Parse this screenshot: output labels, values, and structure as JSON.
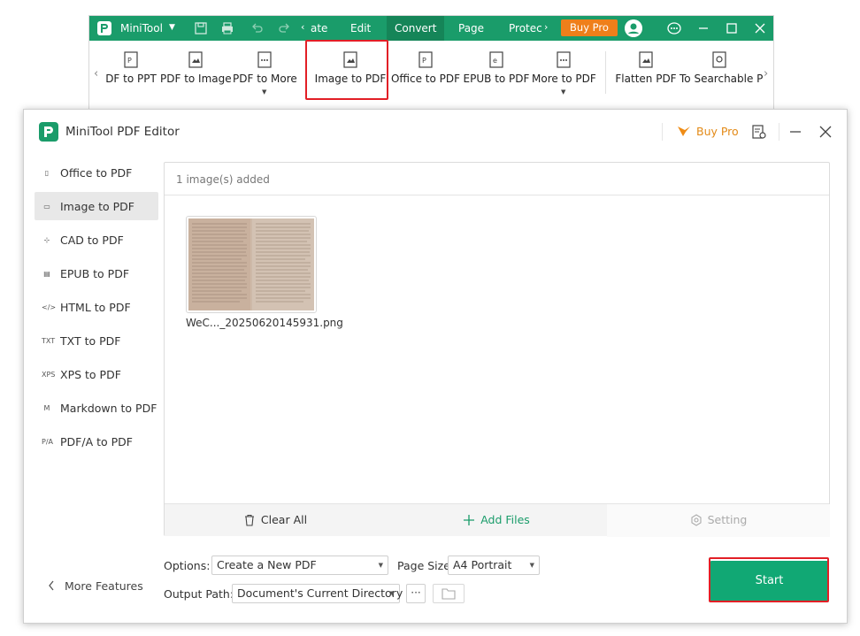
{
  "colors": {
    "brand": "#1a9c6a",
    "buy_pro": "#ef7f1a",
    "highlight": "#e21f26",
    "start": "#11a874"
  },
  "bg_window": {
    "app_name": "MiniTool",
    "menu": [
      "ate",
      "Edit",
      "Convert",
      "Page",
      "Protec"
    ],
    "active_menu": "Convert",
    "buy_pro": "Buy Pro",
    "ribbon": [
      {
        "label": "DF to PPT",
        "icon": "pdf-to-ppt-icon",
        "dropdown": false
      },
      {
        "label": "PDF to Image",
        "icon": "pdf-to-image-icon",
        "dropdown": false
      },
      {
        "label": "PDF to More",
        "icon": "pdf-to-more-icon",
        "dropdown": true
      },
      {
        "label": "Image to PDF",
        "icon": "image-to-pdf-icon",
        "dropdown": false
      },
      {
        "label": "Office to PDF",
        "icon": "office-to-pdf-icon",
        "dropdown": false
      },
      {
        "label": "EPUB to PDF",
        "icon": "epub-to-pdf-icon",
        "dropdown": false
      },
      {
        "label": "More to PDF",
        "icon": "more-to-pdf-icon",
        "dropdown": true
      },
      {
        "label": "Flatten PDF",
        "icon": "flatten-pdf-icon",
        "dropdown": false
      },
      {
        "label": "To Searchable P",
        "icon": "to-searchable-pdf-icon",
        "dropdown": false
      }
    ]
  },
  "dialog": {
    "title": "MiniTool PDF Editor",
    "buy_pro": "Buy Pro",
    "sidebar": [
      {
        "label": "Office to PDF",
        "icon": "office-icon",
        "glyph": "▯",
        "active": false
      },
      {
        "label": "Image to PDF",
        "icon": "image-icon",
        "glyph": "▭",
        "active": true
      },
      {
        "label": "CAD to PDF",
        "icon": "cad-icon",
        "glyph": "⊹",
        "active": false
      },
      {
        "label": "EPUB to PDF",
        "icon": "epub-icon",
        "glyph": "▤",
        "active": false
      },
      {
        "label": "HTML to PDF",
        "icon": "html-icon",
        "glyph": "</>",
        "active": false
      },
      {
        "label": "TXT to PDF",
        "icon": "txt-icon",
        "glyph": "TXT",
        "active": false
      },
      {
        "label": "XPS to PDF",
        "icon": "xps-icon",
        "glyph": "XPS",
        "active": false
      },
      {
        "label": "Markdown to PDF",
        "icon": "markdown-icon",
        "glyph": "M",
        "active": false
      },
      {
        "label": "PDF/A to PDF",
        "icon": "pdfa-icon",
        "glyph": "P/A",
        "active": false
      }
    ],
    "more_features": "More Features",
    "file_count": "1 image(s) added",
    "files": [
      {
        "name": "WeC..._20250620145931.png"
      }
    ],
    "footer": {
      "clear_all": "Clear All",
      "add_files": "Add Files",
      "setting": "Setting"
    },
    "options_label": "Options:",
    "options_value": "Create a New PDF",
    "page_size_label": "Page Size:",
    "page_size_value": "A4 Portrait",
    "output_path_label": "Output Path:",
    "output_path_value": "Document's Current Directory",
    "browse_label": "···",
    "start": "Start"
  }
}
